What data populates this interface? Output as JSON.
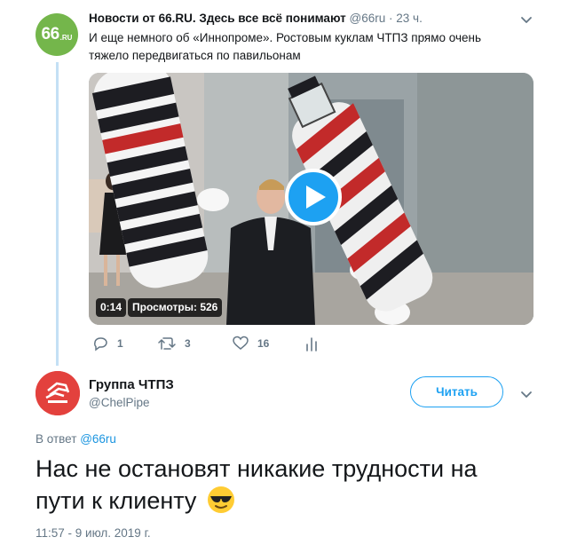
{
  "parent": {
    "name": "Новости от 66.RU. Здесь все всё понимают",
    "handle": "@66ru",
    "dot": "·",
    "time": "23 ч.",
    "text": "И еще немного об «Иннопроме». Ростовым куклам ЧТПЗ прямо очень тяжело передвигаться по павильонам",
    "avatar_logo": {
      "num": "66",
      "suffix": ".RU"
    },
    "media": {
      "duration": "0:14",
      "views": "Просмотры: 526"
    },
    "actions": {
      "replies": "1",
      "retweets": "3",
      "likes": "16"
    }
  },
  "reply": {
    "name": "Группа ЧТПЗ",
    "handle": "@ChelPipe",
    "follow_label": "Читать",
    "in_reply_prefix": "В ответ",
    "in_reply_mention": "@66ru",
    "text": "Нас не остановят никакие трудности на пути к клиенту",
    "emoji": "smiling-face-with-sunglasses",
    "timestamp": "11:57 - 9 июл. 2019 г."
  },
  "colors": {
    "accent": "#1da1f2",
    "thread_line": "#c4e0f5",
    "muted_text": "#657786",
    "parent_avatar_bg": "#74b64b",
    "reply_avatar_bg": "#e3413d"
  }
}
